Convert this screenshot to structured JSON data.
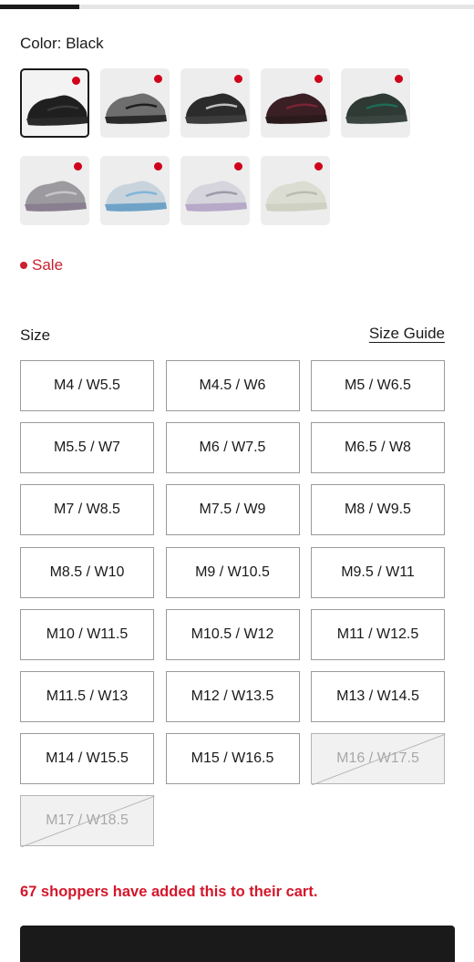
{
  "progress": {
    "fraction": 0.167
  },
  "color": {
    "label": "Color: Black"
  },
  "swatches": [
    {
      "name": "black",
      "shoe": "#1f1f1f",
      "sole": "#2a2a2a",
      "accent": "#3a3a3a",
      "selected": true
    },
    {
      "name": "grey-black",
      "shoe": "#6e6e6e",
      "sole": "#2b2b2b",
      "accent": "#1e1e1e",
      "selected": false
    },
    {
      "name": "black-silver",
      "shoe": "#2b2b2b",
      "sole": "#3c3c3c",
      "accent": "#bfbfbf",
      "selected": false
    },
    {
      "name": "black-burgundy",
      "shoe": "#3a1f24",
      "sole": "#2a1a1c",
      "accent": "#7a2434",
      "selected": false
    },
    {
      "name": "dark-green",
      "shoe": "#2f3a35",
      "sole": "#3a4440",
      "accent": "#1d6b55",
      "selected": false
    },
    {
      "name": "grey-purple",
      "shoe": "#9c9a9e",
      "sole": "#8a7f90",
      "accent": "#c7c4c8",
      "selected": false
    },
    {
      "name": "white-blue",
      "shoe": "#c9d3dc",
      "sole": "#6fa2c7",
      "accent": "#7fb6d8",
      "selected": false
    },
    {
      "name": "white-lilac",
      "shoe": "#d6d4dc",
      "sole": "#b7a9c8",
      "accent": "#9d9aa8",
      "selected": false
    },
    {
      "name": "sea-salt",
      "shoe": "#dcddd2",
      "sole": "#cfd1c3",
      "accent": "#b9bcae",
      "selected": false
    }
  ],
  "sale": {
    "label": "Sale"
  },
  "size": {
    "title": "Size",
    "guide_label": "Size Guide",
    "options": [
      {
        "label": "M4 / W5.5",
        "available": true
      },
      {
        "label": "M4.5 / W6",
        "available": true
      },
      {
        "label": "M5 / W6.5",
        "available": true
      },
      {
        "label": "M5.5 / W7",
        "available": true
      },
      {
        "label": "M6 / W7.5",
        "available": true
      },
      {
        "label": "M6.5 / W8",
        "available": true
      },
      {
        "label": "M7 / W8.5",
        "available": true
      },
      {
        "label": "M7.5 / W9",
        "available": true
      },
      {
        "label": "M8 / W9.5",
        "available": true
      },
      {
        "label": "M8.5 / W10",
        "available": true
      },
      {
        "label": "M9 / W10.5",
        "available": true
      },
      {
        "label": "M9.5 / W11",
        "available": true
      },
      {
        "label": "M10 / W11.5",
        "available": true
      },
      {
        "label": "M10.5 / W12",
        "available": true
      },
      {
        "label": "M11 / W12.5",
        "available": true
      },
      {
        "label": "M11.5 / W13",
        "available": true
      },
      {
        "label": "M12 / W13.5",
        "available": true
      },
      {
        "label": "M13 / W14.5",
        "available": true
      },
      {
        "label": "M14 / W15.5",
        "available": true
      },
      {
        "label": "M15 / W16.5",
        "available": true
      },
      {
        "label": "M16 / W17.5",
        "available": false
      },
      {
        "label": "M17 / W18.5",
        "available": false
      }
    ]
  },
  "cart_note": "67 shoppers have added this to their cart.",
  "colors": {
    "accent_red": "#d3172b",
    "dark": "#1a1a1a"
  }
}
